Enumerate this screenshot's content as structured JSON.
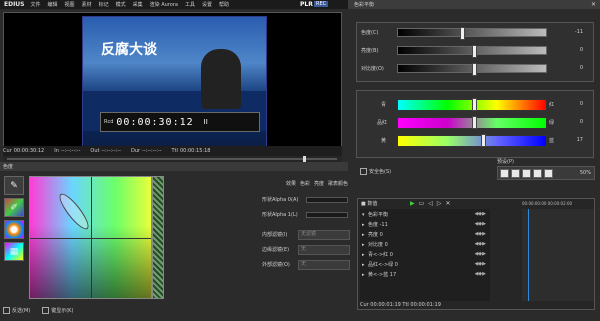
{
  "menubar": {
    "logo": "EDIUS",
    "items": [
      "文件",
      "编辑",
      "视图",
      "素材",
      "标记",
      "模式",
      "采集",
      "渲染 Aurora",
      "工具",
      "设置",
      "帮助"
    ],
    "plr": "PLR",
    "rec": "REC"
  },
  "preview": {
    "title_overlay": "反腐大谈",
    "tc_label": "Rcd",
    "timecode": "00:00:30:12",
    "pause_icon": "II"
  },
  "tcbar": {
    "cur_label": "Cur",
    "cur": "00:00:30:12",
    "in_label": "In",
    "in": "--:--:--:--",
    "out_label": "Out",
    "out": "--:--:--:--",
    "dur_label": "Dur",
    "dur": "--:--:--:--",
    "ttl_label": "Ttl",
    "ttl": "00:00:15:18"
  },
  "left_panel": {
    "header": "色度",
    "tools": [
      "eyedropper-icon",
      "pencil-color-icon",
      "color-wheel-icon",
      "color-swatch-icon"
    ],
    "check_inner": "反选(M)",
    "check_key": "键显示(K)"
  },
  "params": {
    "tabs": [
      "效果",
      "色彩",
      "亮度",
      "歌表颜色"
    ],
    "rows": [
      {
        "label": "形状Alpha 0(A)"
      },
      {
        "label": "形状Alpha 1(L)"
      },
      {
        "label": "内部滤镜(I)",
        "value": "无滤镜"
      },
      {
        "label": "边缘滤镜(E)",
        "value": "无"
      },
      {
        "label": "外部滤镜(O)",
        "value": "无"
      }
    ]
  },
  "right": {
    "title": "色彩平衡",
    "close": "✕",
    "basic": [
      {
        "label": "色度(C)",
        "value": "-11",
        "pos": 0.42
      },
      {
        "label": "亮度(B)",
        "value": "0",
        "pos": 0.5
      },
      {
        "label": "对比度(O)",
        "value": "0",
        "pos": 0.5
      }
    ],
    "color": [
      {
        "left": "青",
        "right": "红",
        "value": "0",
        "pos": 0.5
      },
      {
        "left": "品红",
        "right": "绿",
        "value": "0",
        "pos": 0.5
      },
      {
        "left": "黄",
        "right": "蓝",
        "value": "17",
        "pos": 0.56
      }
    ],
    "safe_label": "安全色(S)",
    "preset_title": "预设(P)",
    "preset_pct": "50%"
  },
  "keyframe": {
    "head": "■ 数值",
    "ruler": "00:00:00:00   00:00:02:00",
    "rows": [
      "色彩平衡",
      "色度 -11",
      "亮度 0",
      "对比度 0",
      "青<->红 0",
      "品红<->绿 0",
      "黄<->蓝 17"
    ],
    "cur": "Cur 00:00:01:19",
    "ttl": "Ttl 00:00:01:19"
  },
  "colors": {
    "accent": "#2a8ad8"
  }
}
